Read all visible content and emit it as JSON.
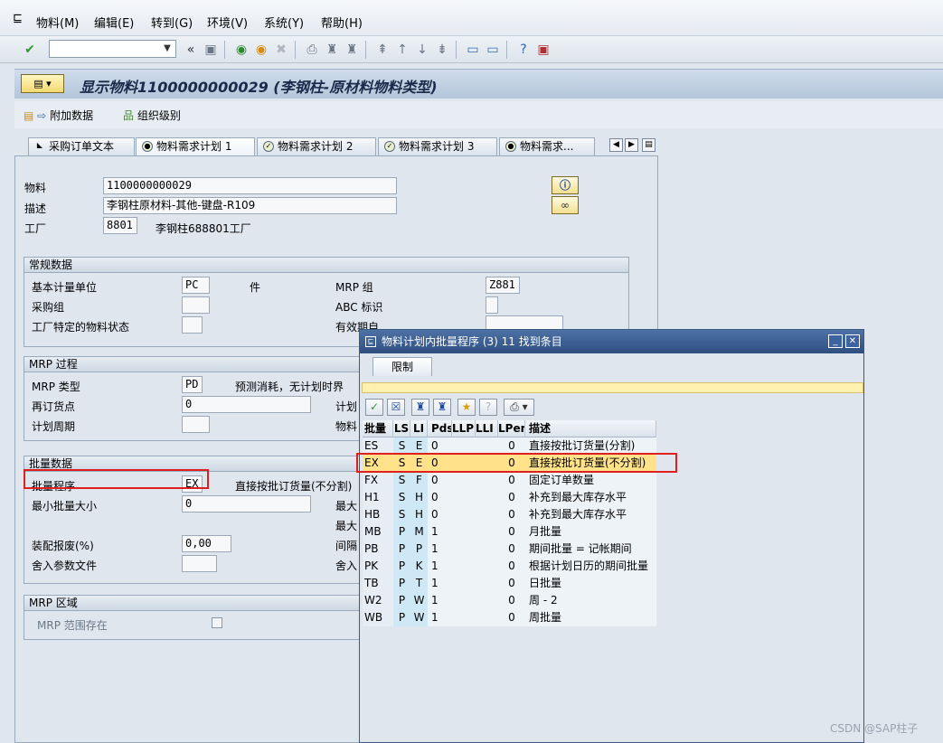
{
  "menubar": {
    "items": [
      "物料(M)",
      "编辑(E)",
      "转到(G)",
      "环境(V)",
      "系统(Y)",
      "帮助(H)"
    ]
  },
  "toolbar": {
    "command_field_value": ""
  },
  "title": "显示物料1100000000029 (李钢柱-原材料物料类型)",
  "appbar": {
    "additional_data": "附加数据",
    "org_levels": "组织级别"
  },
  "tabs": [
    "采购订单文本",
    "物料需求计划 1",
    "物料需求计划 2",
    "物料需求计划 3",
    "物料需求..."
  ],
  "header": {
    "material_label": "物料",
    "material_value": "1100000000029",
    "desc_label": "描述",
    "desc_value": "李钢柱原材料-其他-键盘-R109",
    "plant_label": "工厂",
    "plant_value": "8801",
    "plant_name": "李钢柱688801工厂"
  },
  "general": {
    "title": "常规数据",
    "base_uom_label": "基本计量单位",
    "base_uom_value": "PC",
    "base_uom_text": "件",
    "mrp_group_label": "MRP 组",
    "mrp_group_value": "Z881",
    "purch_group_label": "采购组",
    "abc_label": "ABC 标识",
    "plant_status_label": "工厂特定的物料状态",
    "valid_from_label": "有效期自"
  },
  "mrp_proc": {
    "title": "MRP 过程",
    "mrp_type_label": "MRP 类型",
    "mrp_type_value": "PD",
    "mrp_type_text": "预测消耗，无计划时界",
    "reorder_label": "再订货点",
    "reorder_value": "0",
    "planning_cycle_label": "计划周期",
    "right1": "计划",
    "right2": "物料"
  },
  "lot": {
    "title": "批量数据",
    "lot_proc_label": "批量程序",
    "lot_proc_value": "EX",
    "lot_proc_text": "直接按批订货量(不分割)",
    "min_lot_label": "最小批量大小",
    "min_lot_value": "0",
    "assembly_scrap_label": "装配报废(%)",
    "assembly_scrap_value": "0,00",
    "rounding_label": "舍入参数文件",
    "right1": "最大",
    "right2": "最大",
    "right3": "间隔",
    "right4": "舍入"
  },
  "mrp_area": {
    "title": "MRP 区域",
    "exists_label": "MRP 范围存在"
  },
  "popup": {
    "title": "物料计划内批量程序 (3)  11 找到条目",
    "tab": "限制",
    "columns": [
      "批量",
      "LS",
      "LI",
      "Pds",
      "LLP",
      "LLI",
      "LPer",
      "描述"
    ],
    "rows": [
      [
        "ES",
        "S",
        "E",
        "0",
        "",
        "",
        "0",
        "直接按批订货量(分割)"
      ],
      [
        "EX",
        "S",
        "E",
        "0",
        "",
        "",
        "0",
        "直接按批订货量(不分割)"
      ],
      [
        "FX",
        "S",
        "F",
        "0",
        "",
        "",
        "0",
        "固定订单数量"
      ],
      [
        "H1",
        "S",
        "H",
        "0",
        "",
        "",
        "0",
        "补充到最大库存水平"
      ],
      [
        "HB",
        "S",
        "H",
        "0",
        "",
        "",
        "0",
        "补充到最大库存水平"
      ],
      [
        "MB",
        "P",
        "M",
        "1",
        "",
        "",
        "0",
        "月批量"
      ],
      [
        "PB",
        "P",
        "P",
        "1",
        "",
        "",
        "0",
        "期间批量 = 记帐期间"
      ],
      [
        "PK",
        "P",
        "K",
        "1",
        "",
        "",
        "0",
        "根据计划日历的期间批量"
      ],
      [
        "TB",
        "P",
        "T",
        "1",
        "",
        "",
        "0",
        "日批量"
      ],
      [
        "W2",
        "P",
        "W",
        "1",
        "",
        "",
        "0",
        "周 - 2"
      ],
      [
        "WB",
        "P",
        "W",
        "1",
        "",
        "",
        "0",
        "周批量"
      ]
    ],
    "selected_index": 1
  },
  "watermark": "CSDN @SAP柱子"
}
